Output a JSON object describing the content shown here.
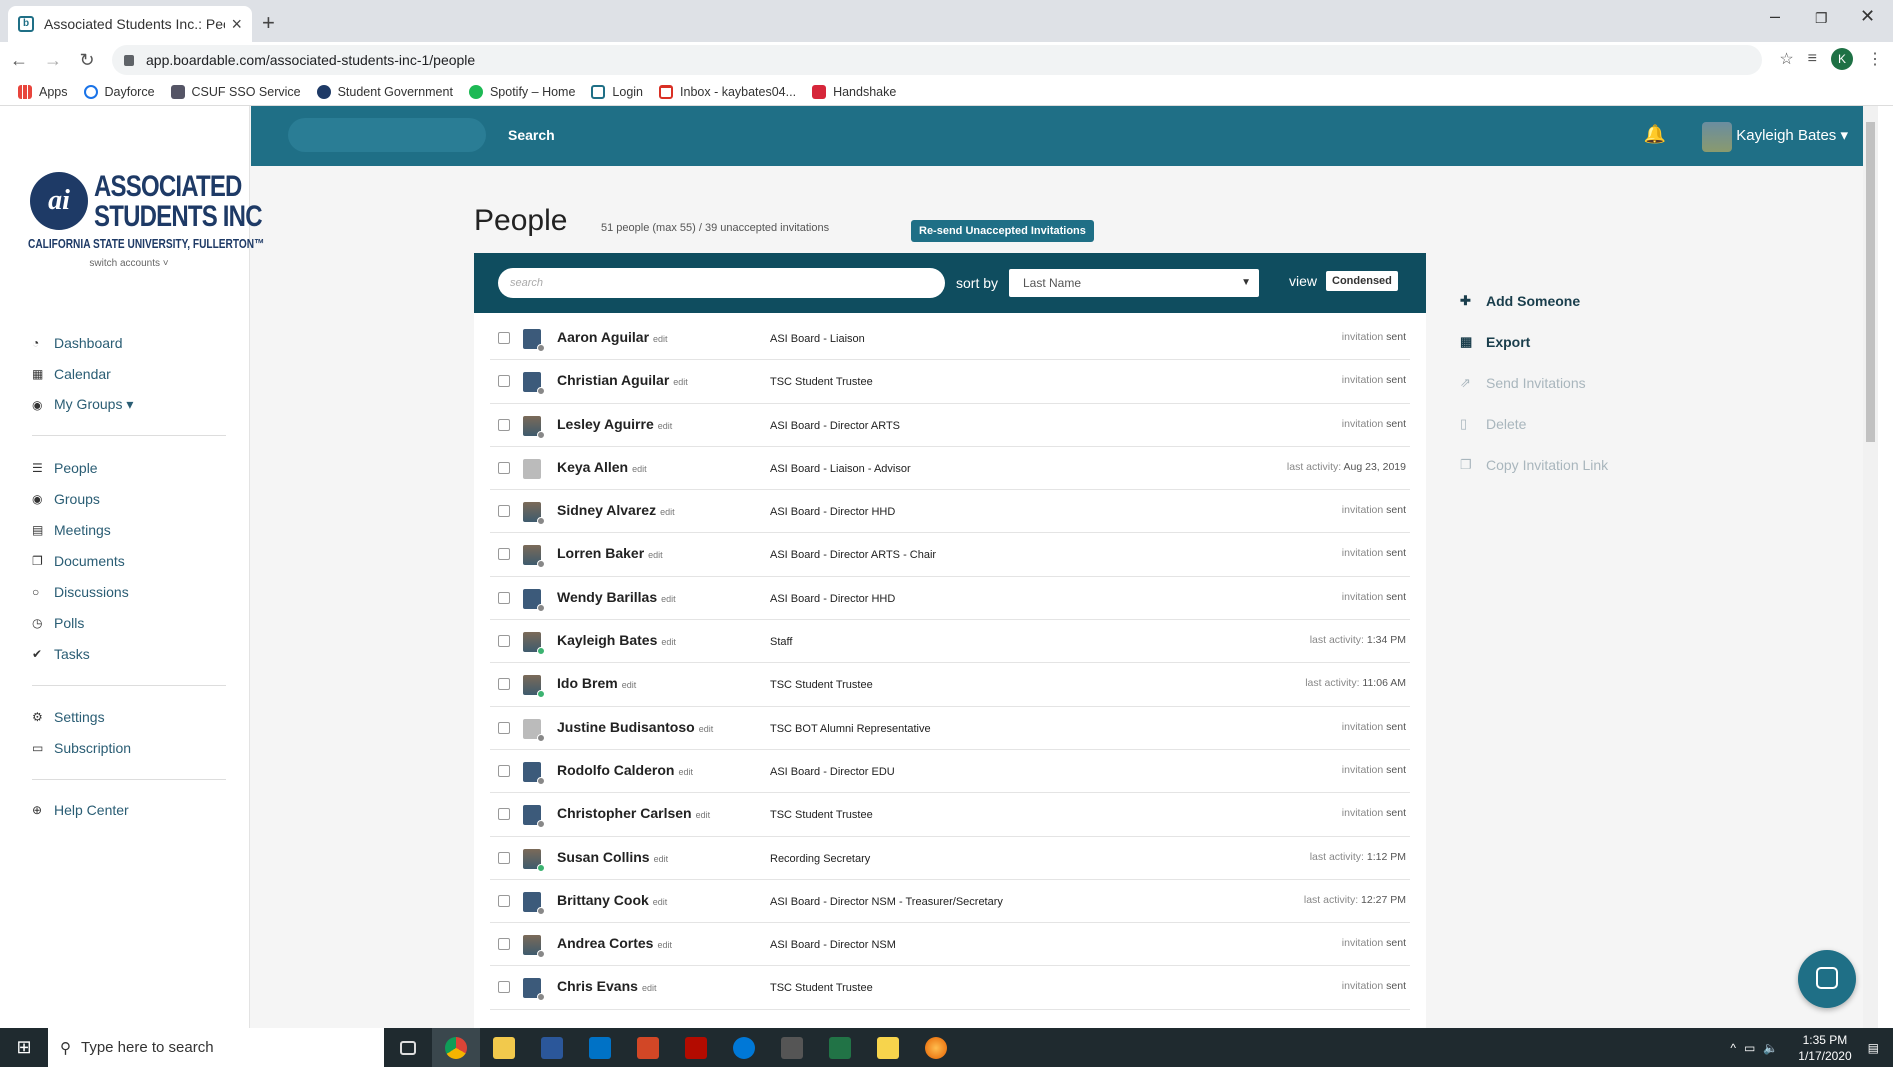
{
  "browser": {
    "tab_title": "Associated Students Inc.: People",
    "url": "app.boardable.com/associated-students-inc-1/people",
    "profile_initial": "K",
    "bookmarks": [
      "Apps",
      "Dayforce",
      "CSUF SSO Service",
      "Student Government",
      "Spotify – Home",
      "Login",
      "Inbox - kaybates04...",
      "Handshake"
    ]
  },
  "sidebar": {
    "logo_line1": "ASSOCIATED",
    "logo_line2": "STUDENTS INC",
    "logo_line3": "CALIFORNIA STATE UNIVERSITY, FULLERTON™",
    "logo_mark": "ai",
    "switch_accounts": "switch accounts ˅",
    "nav1": [
      "Dashboard",
      "Calendar",
      "My Groups ▾"
    ],
    "nav2": [
      "People",
      "Groups",
      "Meetings",
      "Documents",
      "Discussions",
      "Polls",
      "Tasks"
    ],
    "nav3": [
      "Settings",
      "Subscription"
    ],
    "nav4": [
      "Help Center"
    ]
  },
  "topbar": {
    "search_label": "Search",
    "user_name": "Kayleigh Bates ▾"
  },
  "page": {
    "title": "People",
    "meta": "51 people (max 55)   /   39 unaccepted invitations",
    "resend_button": "Re-send Unaccepted Invitations"
  },
  "toolbar": {
    "search_placeholder": "search",
    "sort_label": "sort by",
    "sort_value": "Last Name",
    "view_label": "view",
    "view_value": "Condensed"
  },
  "people": [
    {
      "name": "Aaron Aguilar",
      "role": "ASI Board - Liaison",
      "status_label": "invitation",
      "status_value": "sent"
    },
    {
      "name": "Christian Aguilar",
      "role": "TSC Student Trustee",
      "status_label": "invitation",
      "status_value": "sent"
    },
    {
      "name": "Lesley Aguirre",
      "role": "ASI Board - Director ARTS",
      "status_label": "invitation",
      "status_value": "sent"
    },
    {
      "name": "Keya Allen",
      "role": "ASI Board - Liaison - Advisor",
      "status_label": "last activity:",
      "status_value": "Aug 23, 2019"
    },
    {
      "name": "Sidney Alvarez",
      "role": "ASI Board - Director HHD",
      "status_label": "invitation",
      "status_value": "sent"
    },
    {
      "name": "Lorren Baker",
      "role": "ASI Board - Director ARTS - Chair",
      "status_label": "invitation",
      "status_value": "sent"
    },
    {
      "name": "Wendy Barillas",
      "role": "ASI Board - Director HHD",
      "status_label": "invitation",
      "status_value": "sent"
    },
    {
      "name": "Kayleigh Bates",
      "role": "Staff",
      "status_label": "last activity:",
      "status_value": "1:34 PM"
    },
    {
      "name": "Ido Brem",
      "role": "TSC Student Trustee",
      "status_label": "last activity:",
      "status_value": "11:06 AM"
    },
    {
      "name": "Justine Budisantoso",
      "role": "TSC BOT Alumni Representative",
      "status_label": "invitation",
      "status_value": "sent"
    },
    {
      "name": "Rodolfo Calderon",
      "role": "ASI Board - Director EDU",
      "status_label": "invitation",
      "status_value": "sent"
    },
    {
      "name": "Christopher Carlsen",
      "role": "TSC Student Trustee",
      "status_label": "invitation",
      "status_value": "sent"
    },
    {
      "name": "Susan Collins",
      "role": "Recording Secretary",
      "status_label": "last activity:",
      "status_value": "1:12 PM"
    },
    {
      "name": "Brittany Cook",
      "role": "ASI Board - Director NSM - Treasurer/Secretary",
      "status_label": "last activity:",
      "status_value": "12:27 PM"
    },
    {
      "name": "Andrea Cortes",
      "role": "ASI Board - Director NSM",
      "status_label": "invitation",
      "status_value": "sent"
    },
    {
      "name": "Chris Evans",
      "role": "TSC Student Trustee",
      "status_label": "invitation",
      "status_value": "sent"
    }
  ],
  "edit_label": "edit",
  "actions": [
    "Add Someone",
    "Export",
    "Send Invitations",
    "Delete",
    "Copy Invitation Link"
  ],
  "taskbar": {
    "search_placeholder": "Type here to search",
    "time": "1:35 PM",
    "date": "1/17/2020"
  }
}
